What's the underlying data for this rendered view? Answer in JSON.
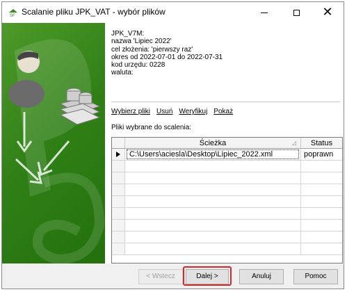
{
  "window": {
    "title": "Scalanie pliku JPK_VAT - wybór plików",
    "icon": "jpk-app-icon"
  },
  "titlebar_controls": [
    "minimize-icon",
    "maximize-icon",
    "close-icon"
  ],
  "info": {
    "line1": "JPK_V7M:",
    "line2": "nazwa 'Lipiec 2022'",
    "line3": "cel złożenia: 'pierwszy raz'",
    "line4": "okres od 2022-07-01 do 2022-07-31",
    "line5": "kod urzędu: 0228",
    "line6": "waluta:"
  },
  "actions": {
    "select": "Wybierz pliki",
    "remove": "Usuń",
    "verify": "Weryfikuj",
    "show": "Pokaż"
  },
  "files_label": "Pliki wybrane do scalenia:",
  "table": {
    "columns": [
      "Ścieżka",
      "Status"
    ],
    "rows": [
      {
        "path": "C:\\Users\\aciesla\\Desktop\\Lipiec_2022.xml",
        "status": "poprawn"
      }
    ]
  },
  "buttons": {
    "back": "< Wstecz",
    "next": "Dalej >",
    "cancel": "Anuluj",
    "help": "Pomoc"
  },
  "colors": {
    "panel_green": "#2f7f16",
    "highlight_red": "#d9262b"
  }
}
